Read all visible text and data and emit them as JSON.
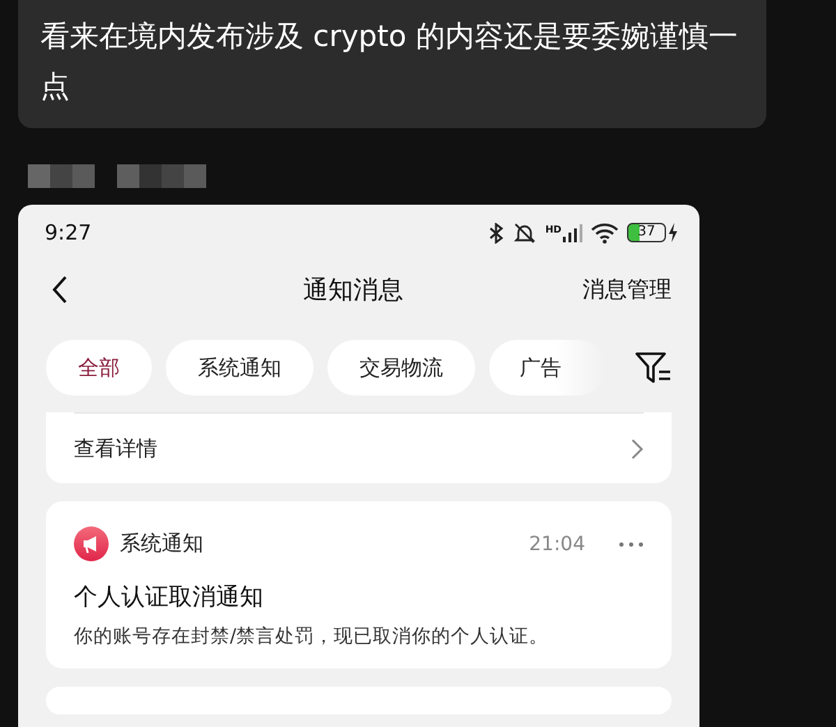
{
  "chat_message": {
    "text": "看来在境内发布涉及 crypto 的内容还是要委婉谨慎一点"
  },
  "screenshot": {
    "status_bar": {
      "time": "9:27",
      "network": "HD",
      "battery": "37"
    },
    "header": {
      "title": "通知消息",
      "action": "消息管理"
    },
    "filters": [
      {
        "label": "全部",
        "selected": true
      },
      {
        "label": "系统通知",
        "selected": false
      },
      {
        "label": "交易物流",
        "selected": false
      },
      {
        "label": "广告",
        "selected": false
      }
    ],
    "cards": [
      {
        "kind": "link",
        "link": "查看详情"
      },
      {
        "kind": "notice",
        "source": "系统通知",
        "time": "21:04",
        "title": "个人认证取消通知",
        "body": "你的账号存在封禁/禁言处罚，现已取消你的个人认证。"
      }
    ]
  }
}
